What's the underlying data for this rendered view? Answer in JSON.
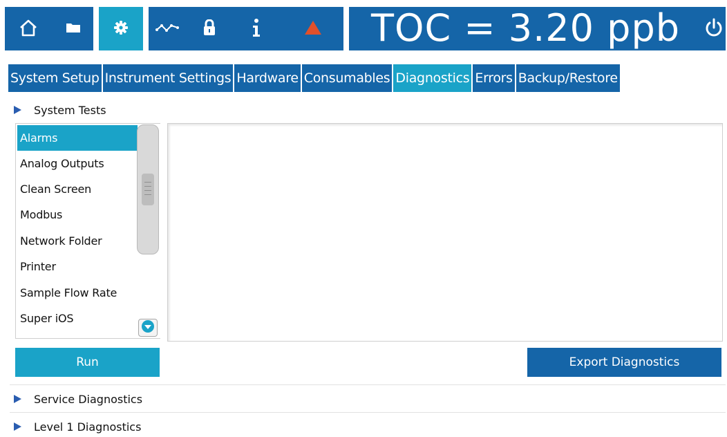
{
  "topbar": {
    "toc_readout": "TOC = 3.20 ppb",
    "icons": [
      "home-icon",
      "folder-icon",
      "gear-icon",
      "trend-icon",
      "lock-icon",
      "info-icon",
      "alarm-triangle-icon",
      "power-icon"
    ],
    "colors": {
      "bar": "#1565a8",
      "active": "#1aa3c8",
      "alarm": "#e0502a"
    }
  },
  "tabs": [
    {
      "label": "System Setup"
    },
    {
      "label": "Instrument Settings"
    },
    {
      "label": "Hardware"
    },
    {
      "label": "Consumables"
    },
    {
      "label": "Diagnostics"
    },
    {
      "label": "Errors"
    },
    {
      "label": "Backup/Restore"
    }
  ],
  "sections": {
    "system_tests": "System Tests",
    "service_diagnostics": "Service Diagnostics",
    "level1_diagnostics": "Level 1 Diagnostics"
  },
  "test_list": {
    "items": [
      "Alarms",
      "Analog Outputs",
      "Clean Screen",
      "Modbus",
      "Network Folder",
      "Printer",
      "Sample Flow Rate",
      "Super iOS"
    ],
    "selected": "Alarms"
  },
  "buttons": {
    "run": "Run",
    "export": "Export Diagnostics"
  }
}
